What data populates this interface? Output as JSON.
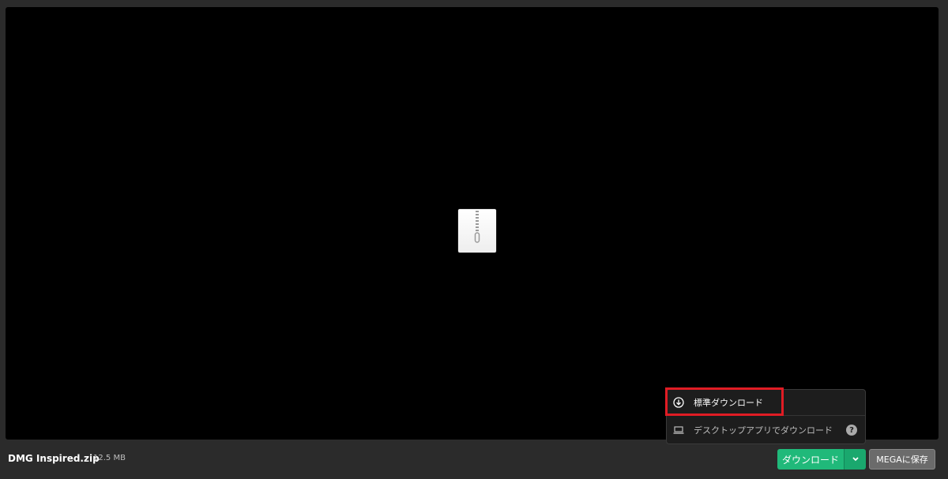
{
  "file": {
    "name": "DMG Inspired.zip",
    "size": "12.5 MB"
  },
  "preview": {
    "icon": "zip-file-icon"
  },
  "actions": {
    "download_label": "ダウンロード",
    "save_label": "MEGAに保存"
  },
  "download_menu": {
    "items": [
      {
        "label": "標準ダウンロード",
        "icon": "download-circle-icon"
      },
      {
        "label": "デスクトップアプリでダウンロード",
        "icon": "laptop-icon",
        "help": "?"
      }
    ]
  },
  "colors": {
    "accent": "#20b97a",
    "highlight": "#e01c24"
  }
}
